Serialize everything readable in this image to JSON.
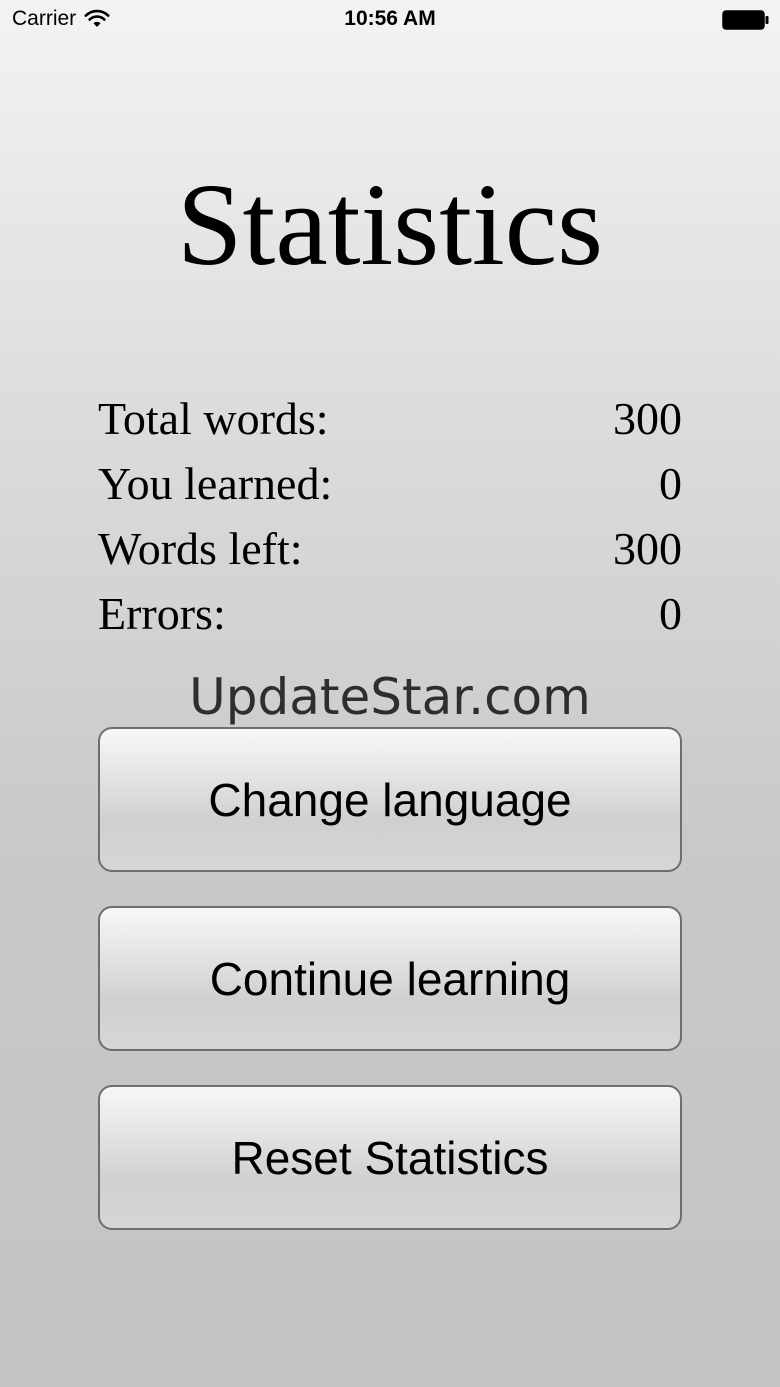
{
  "status_bar": {
    "carrier": "Carrier",
    "time": "10:56 AM",
    "wifi_icon": "wifi-icon",
    "battery_icon": "battery-icon"
  },
  "title": "Statistics",
  "stats": [
    {
      "label": "Total words:",
      "value": "300"
    },
    {
      "label": "You learned:",
      "value": "0"
    },
    {
      "label": "Words left:",
      "value": "300"
    },
    {
      "label": "Errors:",
      "value": "0"
    }
  ],
  "watermark": "UpdateStar.com",
  "buttons": {
    "change_language": "Change language",
    "continue_learning": "Continue learning",
    "reset_statistics": "Reset Statistics"
  },
  "colors": {
    "button_border": "#6e6e6e",
    "watermark": "#2e2e2e"
  }
}
